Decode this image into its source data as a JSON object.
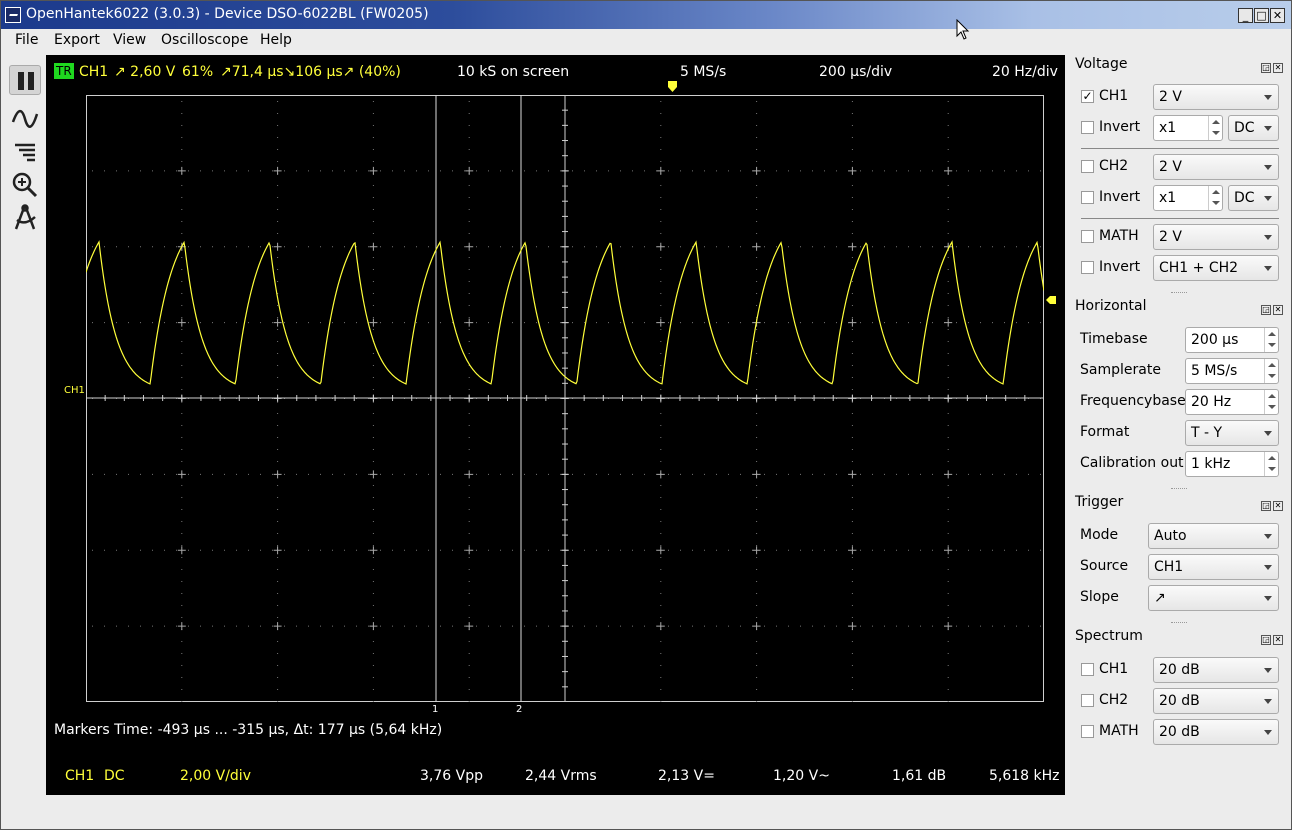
{
  "window": {
    "title": "OpenHantek6022 (3.0.3) - Device DSO-6022BL (FW0205)",
    "min": "_",
    "max": "□",
    "close": "✕"
  },
  "menu": [
    "File",
    "Export",
    "View",
    "Oscilloscope",
    "Help"
  ],
  "toolbar": {
    "icons": [
      "pause-icon",
      "wave-icon",
      "lines-icon",
      "zoom-icon",
      "measure-icon"
    ]
  },
  "scope": {
    "trigger_badge": "TR",
    "ch": "CH1",
    "slope_value": "↗ 2,60 V",
    "duty": "61%",
    "timing": "↗71,4 µs↘106 µs↗ (40%)",
    "samples_on_screen": "10 kS on screen",
    "samplerate": "5 MS/s",
    "timebase": "200 µs/div",
    "freqbase": "20 Hz/div",
    "ch_label": "CH1",
    "marker1": "1",
    "marker2": "2",
    "markers_text": "Markers  Time: -493 µs ... -315 µs,  Δt: 177 µs (5,64 kHz)",
    "footer": {
      "ch": "CH1",
      "coupling": "DC",
      "vdiv": "2,00 V/div",
      "vpp": "3,76 Vpp",
      "vrms": "2,44 Vrms",
      "vdc": "2,13 V=",
      "vac": "1,20 V~",
      "db": "1,61 dB",
      "freq": "5,618 kHz"
    },
    "colors": {
      "trace": "#ffff3a",
      "background": "#000000",
      "trigger_badge": "#1fd81f"
    }
  },
  "dock": {
    "voltage": {
      "title": "Voltage",
      "ch1": {
        "label": "CH1",
        "checked": "✓",
        "gain": "2 V",
        "invert": "Invert",
        "probe": "x1",
        "coupling": "DC"
      },
      "ch2": {
        "label": "CH2",
        "checked": "",
        "gain": "2 V",
        "invert": "Invert",
        "probe": "x1",
        "coupling": "DC"
      },
      "math": {
        "label": "MATH",
        "checked": "",
        "gain": "2 V",
        "invert": "Invert",
        "mode": "CH1 + CH2"
      }
    },
    "horizontal": {
      "title": "Horizontal",
      "timebase_label": "Timebase",
      "timebase": "200 µs",
      "samplerate_label": "Samplerate",
      "samplerate": "5 MS/s",
      "frequencybase_label": "Frequencybase",
      "frequencybase": "20 Hz",
      "format_label": "Format",
      "format": "T - Y",
      "calibration_label": "Calibration out",
      "calibration": "1 kHz"
    },
    "trigger": {
      "title": "Trigger",
      "mode_label": "Mode",
      "mode": "Auto",
      "source_label": "Source",
      "source": "CH1",
      "slope_label": "Slope",
      "slope": "↗"
    },
    "spectrum": {
      "title": "Spectrum",
      "ch1": {
        "label": "CH1",
        "value": "20 dB"
      },
      "ch2": {
        "label": "CH2",
        "value": "20 dB"
      },
      "math": {
        "label": "MATH",
        "value": "20 dB"
      }
    }
  }
}
